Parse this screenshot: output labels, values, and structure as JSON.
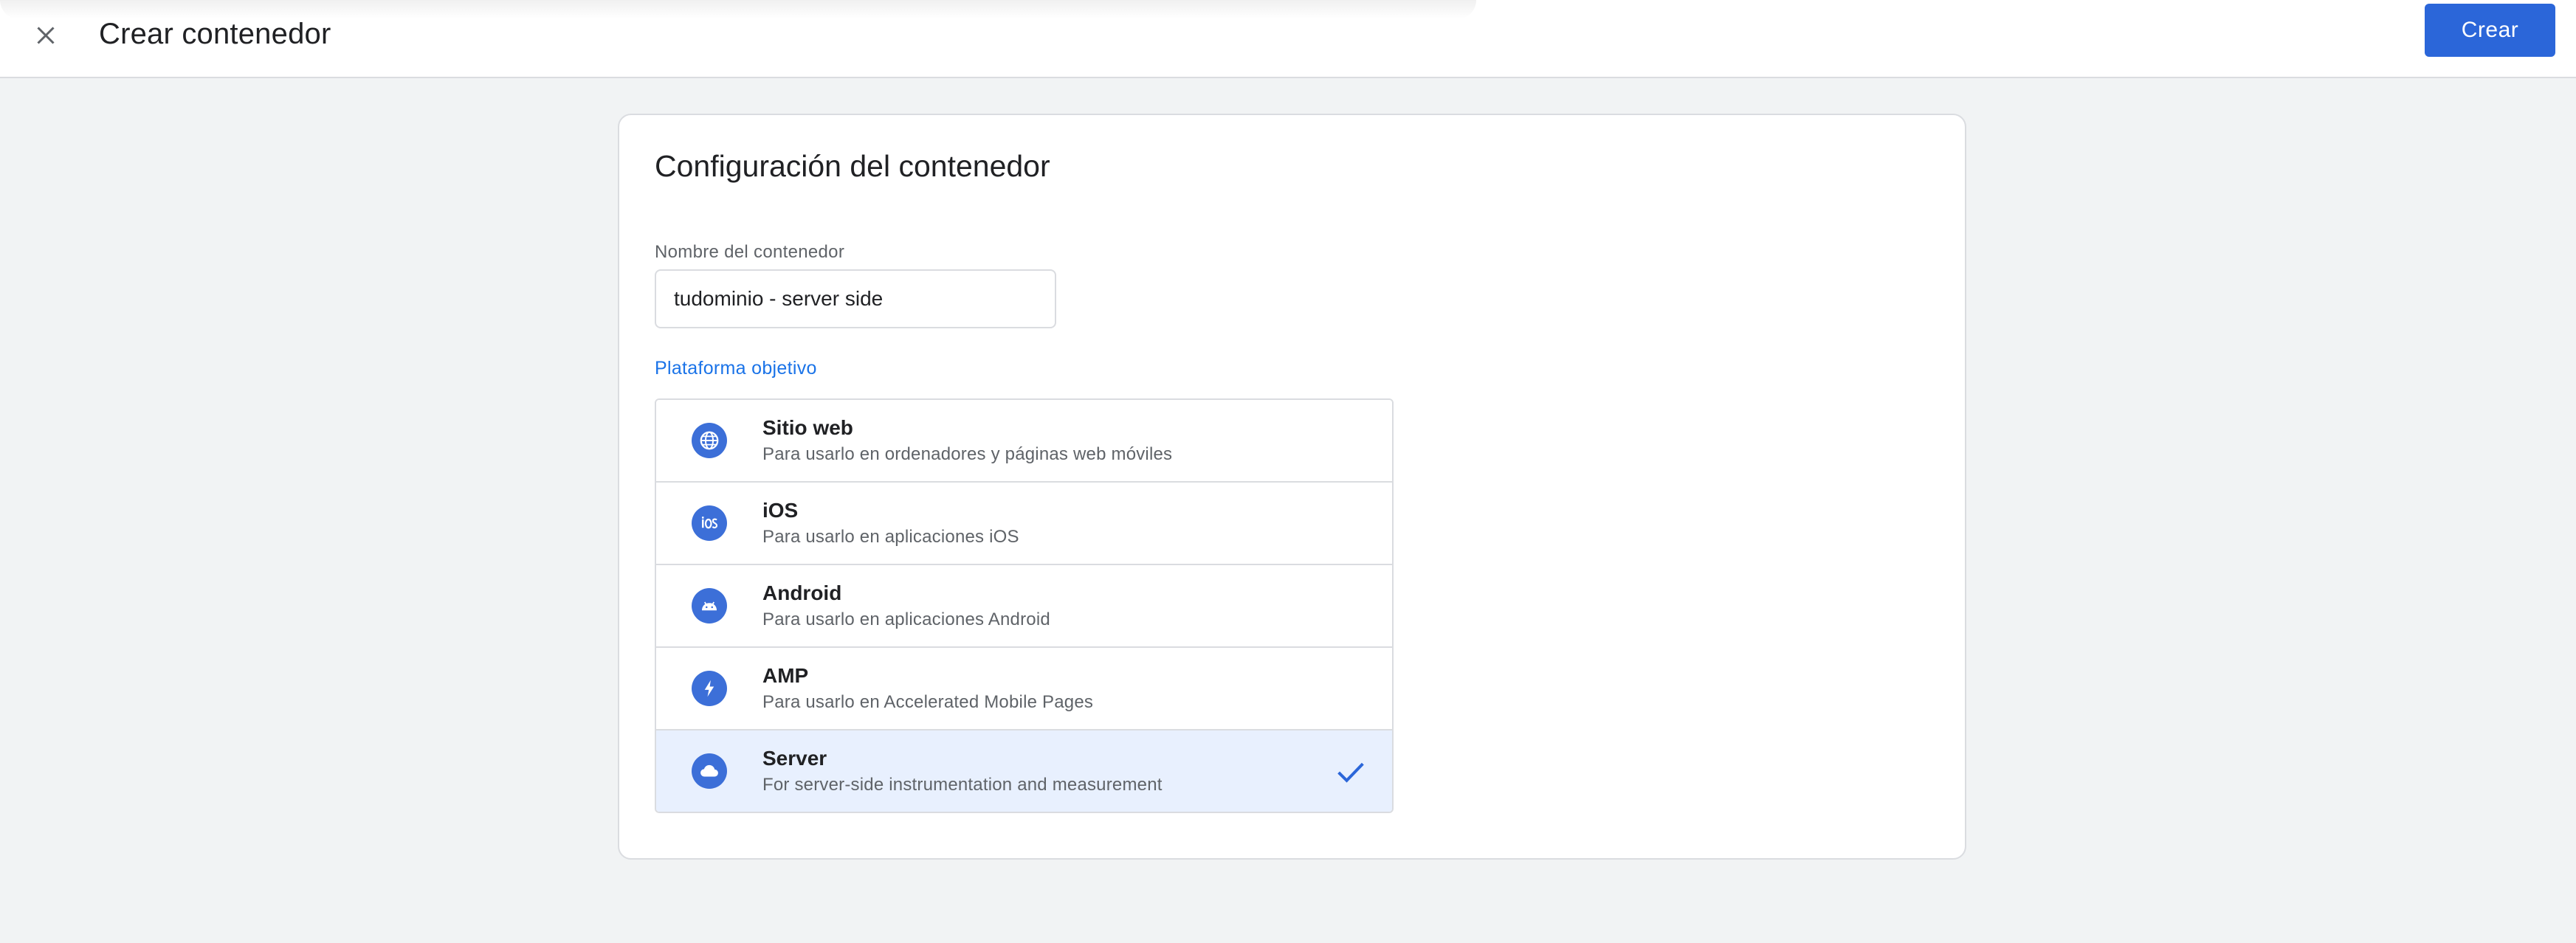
{
  "header": {
    "title": "Crear contenedor",
    "create_label": "Crear"
  },
  "card": {
    "title": "Configuración del contenedor",
    "name_field": {
      "label": "Nombre del contenedor",
      "value": "tudominio - server side"
    },
    "platform_label": "Plataforma objetivo",
    "platforms": [
      {
        "icon": "globe-icon",
        "name": "Sitio web",
        "description": "Para usarlo en ordenadores y páginas web móviles",
        "selected": false
      },
      {
        "icon": "ios-icon",
        "name": "iOS",
        "description": "Para usarlo en aplicaciones iOS",
        "selected": false
      },
      {
        "icon": "android-icon",
        "name": "Android",
        "description": "Para usarlo en aplicaciones Android",
        "selected": false
      },
      {
        "icon": "amp-icon",
        "name": "AMP",
        "description": "Para usarlo en Accelerated Mobile Pages",
        "selected": false
      },
      {
        "icon": "cloud-icon",
        "name": "Server",
        "description": "For server-side instrumentation and measurement",
        "selected": true
      }
    ]
  },
  "colors": {
    "accent": "#1a73e8",
    "button": "#2b66d9",
    "selected_row": "#e8f0fe",
    "icon_bg": "#3c6fd8"
  }
}
